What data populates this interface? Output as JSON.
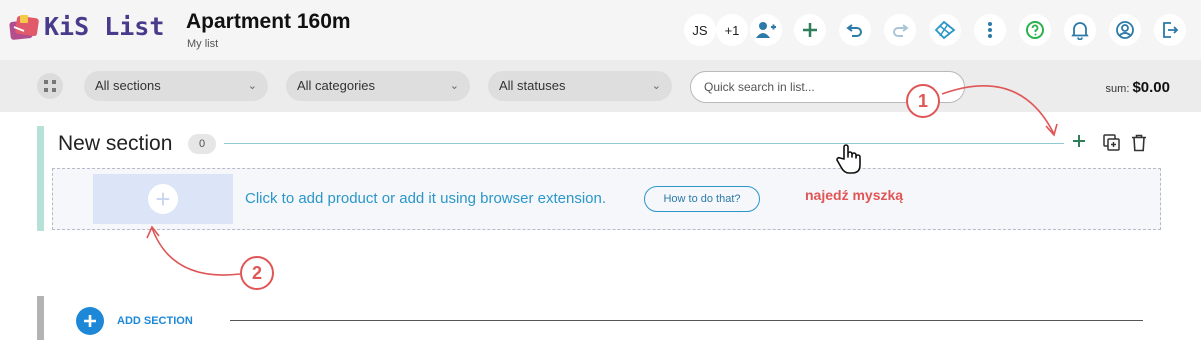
{
  "app": {
    "brand": "KiS List"
  },
  "header": {
    "title": "Apartment 160m",
    "subtitle": "My list",
    "user_initials": "JS",
    "extra_users": "+1",
    "icons": [
      "add-user-icon",
      "plus-icon",
      "undo-icon",
      "redo-icon",
      "browser-extension-icon",
      "more-icon",
      "help-icon",
      "bell-icon",
      "account-icon",
      "logout-icon"
    ],
    "accent_color": "#2e7d5b",
    "help_color": "#2bb14c",
    "extension_color": "#2b97c9"
  },
  "filters": {
    "sections": "All sections",
    "categories": "All categories",
    "statuses": "All statuses",
    "search_placeholder": "Quick search in list...",
    "sum_label": "sum:",
    "sum_value": "$0.00"
  },
  "section": {
    "title": "New section",
    "count": "0",
    "dropzone_text": "Click to add product or add it using browser extension.",
    "howto_label": "How to do that?",
    "hover_note": "najedź myszką",
    "bar_color": "#b7e0d8"
  },
  "annotations": {
    "step1": "1",
    "step2": "2",
    "color": "#e05555"
  },
  "add_section": {
    "label": "ADD SECTION",
    "color": "#1e88d8"
  }
}
